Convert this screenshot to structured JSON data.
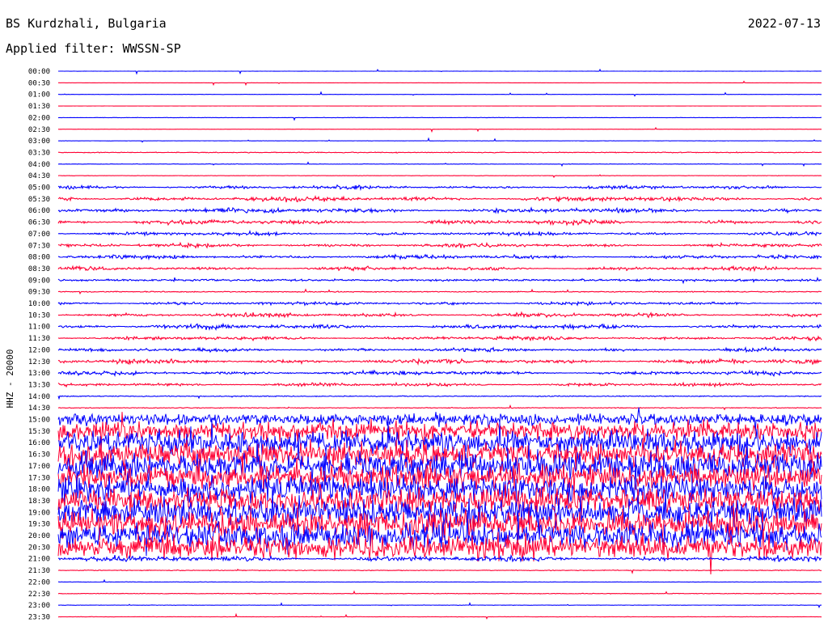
{
  "header": {
    "station": "BS Kurdzhali, Bulgaria",
    "date": "2022-07-13",
    "filter": "Applied filter: WWSSN-SP"
  },
  "axis": {
    "ylabel": "HHZ - 20000"
  },
  "colors": {
    "blue_trace": "#0000ff",
    "red_trace": "#ff0033",
    "background": "#ffffff",
    "text": "#000000"
  },
  "chart_data": {
    "type": "line",
    "title": "BS Kurdzhali, Bulgaria",
    "subtitle": "Applied filter: WWSSN-SP",
    "date": "2022-07-13",
    "xlabel": "",
    "ylabel": "HHZ - 20000",
    "row_colors": [
      "#0000ff",
      "#ff0033"
    ],
    "rows": [
      {
        "time": "00:00",
        "activity": 0.03
      },
      {
        "time": "00:30",
        "activity": 0.02
      },
      {
        "time": "01:00",
        "activity": 0.03
      },
      {
        "time": "01:30",
        "activity": 0.02
      },
      {
        "time": "02:00",
        "activity": 0.05
      },
      {
        "time": "02:30",
        "activity": 0.02
      },
      {
        "time": "03:00",
        "activity": 0.04
      },
      {
        "time": "03:30",
        "activity": 0.1
      },
      {
        "time": "04:00",
        "activity": 0.05
      },
      {
        "time": "04:30",
        "activity": 0.05
      },
      {
        "time": "05:00",
        "activity": 0.55
      },
      {
        "time": "05:30",
        "activity": 0.75
      },
      {
        "time": "06:00",
        "activity": 0.75
      },
      {
        "time": "06:30",
        "activity": 0.7
      },
      {
        "time": "07:00",
        "activity": 0.55
      },
      {
        "time": "07:30",
        "activity": 0.6
      },
      {
        "time": "08:00",
        "activity": 0.6
      },
      {
        "time": "08:30",
        "activity": 0.55
      },
      {
        "time": "09:00",
        "activity": 0.25
      },
      {
        "time": "09:30",
        "activity": 0.12
      },
      {
        "time": "10:00",
        "activity": 0.55
      },
      {
        "time": "10:30",
        "activity": 0.65
      },
      {
        "time": "11:00",
        "activity": 0.7
      },
      {
        "time": "11:30",
        "activity": 0.6
      },
      {
        "time": "12:00",
        "activity": 0.55
      },
      {
        "time": "12:30",
        "activity": 0.7
      },
      {
        "time": "13:00",
        "activity": 0.65
      },
      {
        "time": "13:30",
        "activity": 0.55
      },
      {
        "time": "14:00",
        "activity": 0.12
      },
      {
        "time": "14:30",
        "activity": 0.1
      },
      {
        "time": "15:00",
        "activity": 1.5
      },
      {
        "time": "15:30",
        "activity": 2.4
      },
      {
        "time": "16:00",
        "activity": 3.0
      },
      {
        "time": "16:30",
        "activity": 3.2
      },
      {
        "time": "17:00",
        "activity": 3.3
      },
      {
        "time": "17:30",
        "activity": 3.3
      },
      {
        "time": "18:00",
        "activity": 3.3
      },
      {
        "time": "18:30",
        "activity": 3.3
      },
      {
        "time": "19:00",
        "activity": 3.3
      },
      {
        "time": "19:30",
        "activity": 3.3
      },
      {
        "time": "20:00",
        "activity": 3.3
      },
      {
        "time": "20:30",
        "activity": 3.0
      },
      {
        "time": "21:00",
        "activity": 0.8
      },
      {
        "time": "21:30",
        "activity": 0.1
      },
      {
        "time": "22:00",
        "activity": 0.05
      },
      {
        "time": "22:30",
        "activity": 0.08
      },
      {
        "time": "23:00",
        "activity": 0.05
      },
      {
        "time": "23:30",
        "activity": 0.05
      }
    ]
  }
}
